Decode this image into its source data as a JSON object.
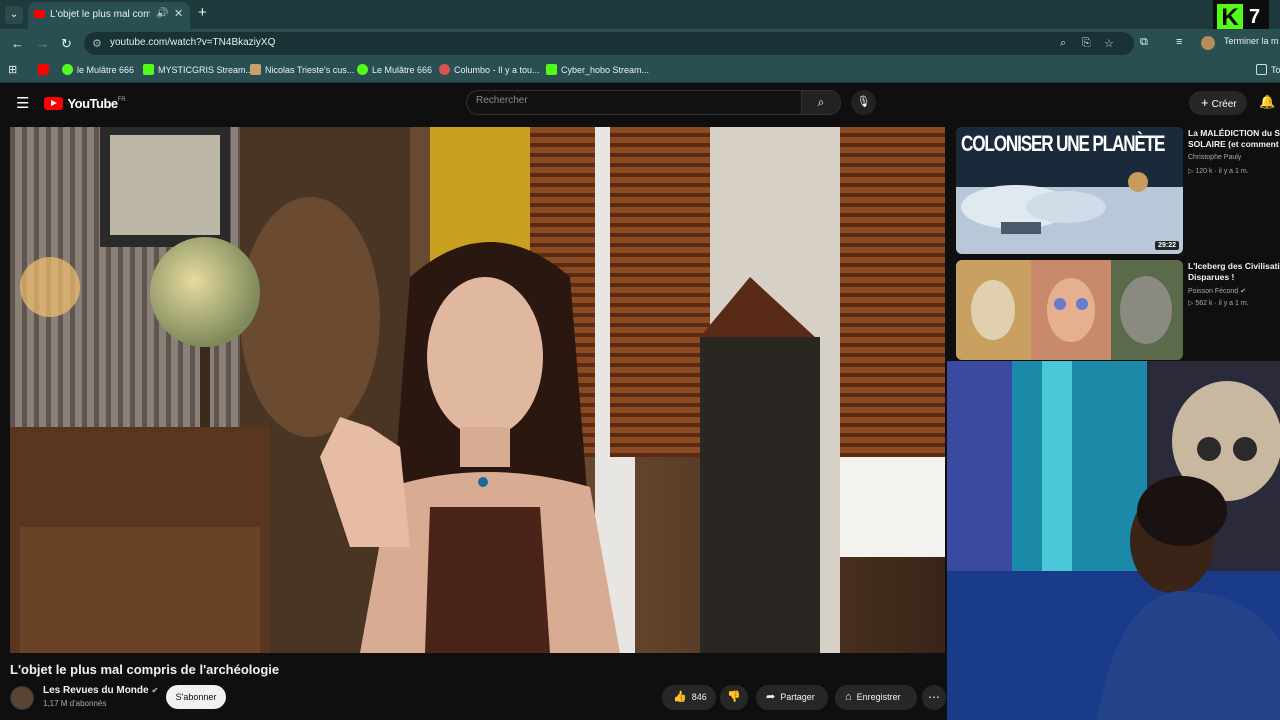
{
  "browser": {
    "tab_title": "L'objet le plus mal compris de l'archéologie",
    "url": "youtube.com/watch?v=TN4BkaziyXQ",
    "profile_action": "Terminer la m",
    "bookmarks": [
      {
        "label": "",
        "color": "#ff0000"
      },
      {
        "label": "le Mulâtre 666",
        "color": "#53fc18"
      },
      {
        "label": "MYSTICGRIS Stream...",
        "color": "#53fc18"
      },
      {
        "label": "Nicolas Trieste's cus...",
        "color": "#c9a06a"
      },
      {
        "label": "Le Mulâtre 666",
        "color": "#53fc18"
      },
      {
        "label": "Columbo - Il y a tou...",
        "color": "#d9534f"
      },
      {
        "label": "Cyber_hobo Stream...",
        "color": "#53fc18"
      },
      {
        "label": "To",
        "color": ""
      }
    ]
  },
  "overlay": {
    "badge_letter": "K",
    "badge_number": "7"
  },
  "youtube": {
    "logo_text": "YouTube",
    "region": "FR",
    "search_placeholder": "Rechercher",
    "create_label": "Créer"
  },
  "video": {
    "title": "L'objet le plus mal compris de l'archéologie",
    "channel": "Les Revues du Monde",
    "subscribers": "1,17 M d'abonnés",
    "subscribe_label": "S'abonner",
    "likes": "846",
    "share_label": "Partager",
    "save_label": "Enregistrer"
  },
  "recommendations": [
    {
      "thumb_text": "COLONISER UNE PLANÈTE",
      "title_line1": "La MALÉDICTION du SY",
      "title_line2": "SOLAIRE (et comment l",
      "channel": "Christophe Pauly",
      "meta": "120 k · il y a 1 m.",
      "duration": "29:22"
    },
    {
      "thumb_text": "",
      "title_line1": "L'Iceberg des Civilisatio",
      "title_line2": "Disparues !",
      "channel": "Poisson Fécond",
      "meta": "562 k · il y a 1 m.",
      "duration": ""
    }
  ],
  "colors": {
    "yt_red": "#ff0000",
    "chrome_teal": "#2a4f52",
    "kick_green": "#53fc18"
  }
}
